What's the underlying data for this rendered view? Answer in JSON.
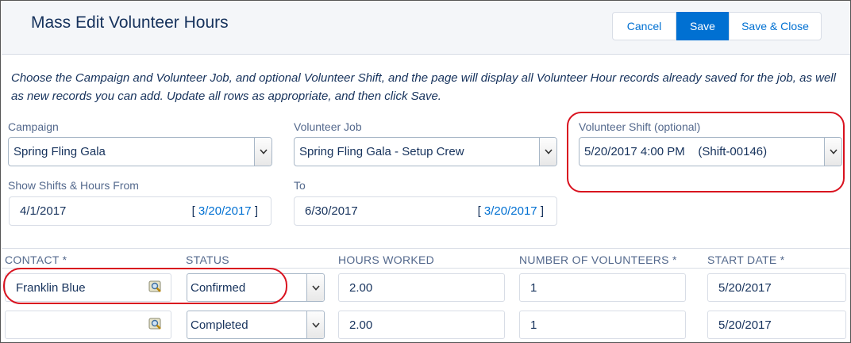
{
  "header": {
    "title": "Mass Edit Volunteer Hours",
    "buttons": {
      "cancel": "Cancel",
      "save": "Save",
      "save_close": "Save & Close"
    }
  },
  "instructions": "Choose the Campaign and Volunteer Job, and optional Volunteer Shift, and the page will display all Volunteer Hour records already saved for the job, as well as new records you can add. Update all rows as appropriate, and then click Save.",
  "filters": {
    "campaign": {
      "label": "Campaign",
      "value": "Spring Fling Gala"
    },
    "job": {
      "label": "Volunteer Job",
      "value": "Spring Fling Gala - Setup Crew"
    },
    "shift": {
      "label": "Volunteer Shift (optional)",
      "value": "5/20/2017 4:00 PM    (Shift-00146)"
    },
    "from": {
      "label": "Show Shifts & Hours From",
      "value": "4/1/2017",
      "link_open": "[ ",
      "today": "3/20/2017",
      "link_close": " ]"
    },
    "to": {
      "label": "To",
      "value": "6/30/2017",
      "link_open": "[ ",
      "today": "3/20/2017",
      "link_close": " ]"
    }
  },
  "table": {
    "columns": {
      "contact": "CONTACT *",
      "status": "STATUS",
      "hours": "HOURS WORKED",
      "volunteers": "NUMBER OF VOLUNTEERS *",
      "start": "START DATE *"
    },
    "rows": [
      {
        "contact": "Franklin Blue",
        "status": "Confirmed",
        "hours": "2.00",
        "volunteers": "1",
        "start": "5/20/2017"
      },
      {
        "contact": "",
        "status": "Completed",
        "hours": "2.00",
        "volunteers": "1",
        "start": "5/20/2017"
      }
    ]
  },
  "colors": {
    "brand": "#0070d2",
    "highlight": "#d9121f",
    "text": "#16325c",
    "label": "#54698d"
  },
  "icons": {
    "dropdown": "chevron-down-icon",
    "lookup": "magnifier-lookup-icon"
  }
}
